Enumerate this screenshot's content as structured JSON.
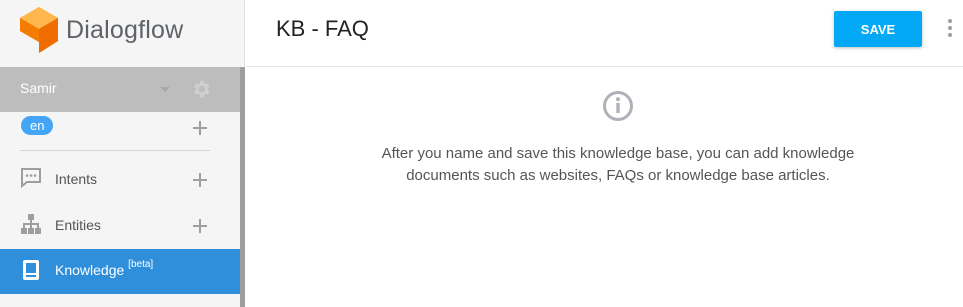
{
  "app": {
    "brand": "Dialogflow"
  },
  "sidebar": {
    "agent_name": "Samir",
    "language": "en",
    "items": [
      {
        "label": "Intents",
        "icon": "chat-icon"
      },
      {
        "label": "Entities",
        "icon": "hierarchy-icon"
      },
      {
        "label": "Knowledge",
        "badge": "[beta]",
        "icon": "book-icon",
        "active": true
      }
    ]
  },
  "header": {
    "title": "KB - FAQ",
    "save_label": "SAVE"
  },
  "main": {
    "message": "After you name and save this knowledge base, you can add knowledge documents such as websites, FAQs or knowledge base articles."
  },
  "colors": {
    "accent": "#03a9f4",
    "active_nav": "#2f8fdb",
    "logo_orange": "#f57c00"
  }
}
